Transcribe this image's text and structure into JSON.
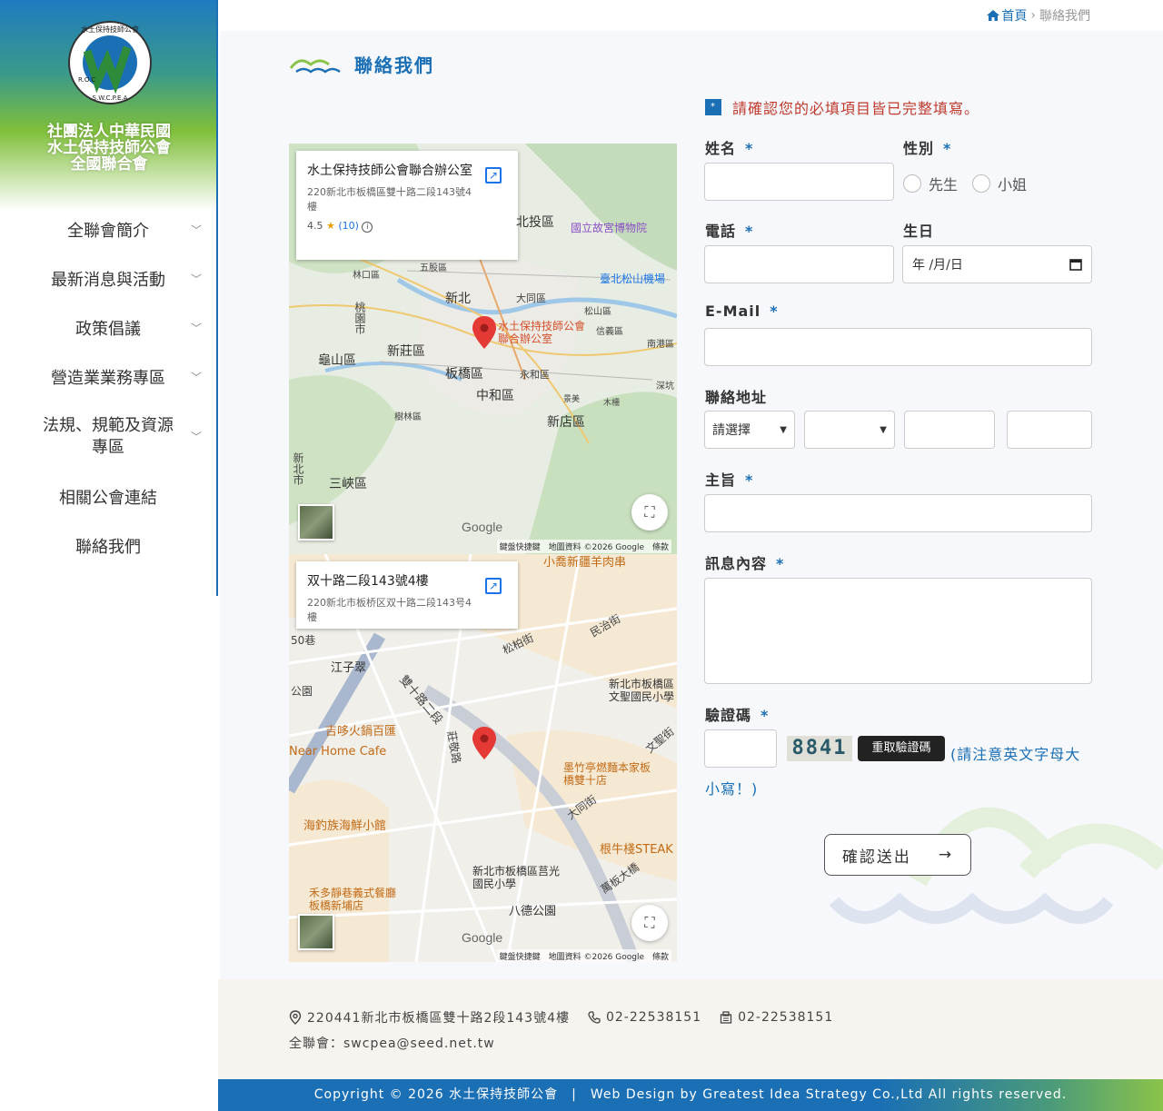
{
  "sidebar": {
    "org_name_line1": "社團法人中華民國",
    "org_name_line2": "水土保持技師公會",
    "org_name_line3": "全國聯合會",
    "logo_ring_text": "水土保持技師公會",
    "logo_left_text": "R.O.C",
    "logo_bottom_text": "S.W.C.P.E.A",
    "logo_letter": "W",
    "items": [
      {
        "label": "全聯會簡介",
        "has_submenu": true
      },
      {
        "label": "最新消息與活動",
        "has_submenu": true
      },
      {
        "label": "政策倡議",
        "has_submenu": true
      },
      {
        "label": "營造業業務專區",
        "has_submenu": true
      },
      {
        "label": "法規、規範及資源專區",
        "has_submenu": true
      },
      {
        "label": "相關公會連結",
        "has_submenu": false
      },
      {
        "label": "聯絡我們",
        "has_submenu": false
      }
    ]
  },
  "breadcrumb": {
    "home": "首頁",
    "separator": "›",
    "current": "聯絡我們"
  },
  "page_title": "聯絡我們",
  "map": {
    "top": {
      "card_title": "水土保持技師公會聯合辦公室",
      "card_address": "220新北市板橋區雙十路二段143號4樓",
      "rating": "4.5",
      "reviews": "(10)",
      "pin_label": "水土保持技師公會聯合辦公室",
      "places": [
        "北投區",
        "國立故宮博物院",
        "臺北松山機場",
        "五股區",
        "林口區",
        "新北",
        "大同區",
        "松山區",
        "信義區",
        "南港區",
        "新莊區",
        "龜山區",
        "板橋區",
        "永和區",
        "中和區",
        "景美",
        "木柵",
        "深坑",
        "樹林區",
        "新店區",
        "三峽區",
        "新北市",
        "桃園市"
      ],
      "footer": "鍵盤快捷鍵　地圖資料 ©2026 Google　條款",
      "google": "Google"
    },
    "bottom": {
      "card_title": "双十路二段143號4樓",
      "card_address": "220新北市板桥区双十路二段143号4樓",
      "places": [
        "小喬新疆羊肉串",
        "民治街",
        "松柏街",
        "50巷",
        "江子翠",
        "雙十路二段",
        "公園",
        "新北市板橋區文聖國民小學",
        "吉哆火鍋百匯",
        "Near Home Cafe",
        "莊敬路",
        "墨竹亭燃麵本家板橋雙十店",
        "文聖街",
        "大同街",
        "海釣族海鮮小館",
        "根牛棧STEAK",
        "萬板大橋",
        "新北市板橋區莒光國民小學",
        "禾多靜巷義式餐廳板橋新埔店",
        "八德公園"
      ],
      "footer": "鍵盤快捷鍵　地圖資料 ©2026 Google　條款",
      "google": "Google"
    }
  },
  "form": {
    "notice": "請確認您的必填項目皆已完整填寫。",
    "required_mark": "*",
    "name_label": "姓名",
    "gender_label": "性別",
    "gender_options": [
      "先生",
      "小姐"
    ],
    "phone_label": "電話",
    "birthday_label": "生日",
    "birthday_placeholder": "年 /月/日",
    "email_label": "E-Mail",
    "address_label": "聯絡地址",
    "address_select1": "請選擇",
    "subject_label": "主旨",
    "message_label": "訊息內容",
    "captcha_label": "驗證碼",
    "captcha_code": "8841",
    "captcha_refresh": "重取驗證碼",
    "captcha_note": "(請注意英文字母大小寫！)",
    "submit_label": "確認送出",
    "submit_arrow": "→"
  },
  "footer": {
    "address": "220441新北市板橋區雙十路2段143號4樓",
    "phone": "02-22538151",
    "fax": "02-22538151",
    "email_line": "全聯會：swcpea@seed.net.tw",
    "copyright": "Copyright © 2026 水土保持技師公會　|　Web Design by Greatest Idea Strategy Co.,Ltd All rights reserved."
  },
  "colors": {
    "brand_blue": "#1a6fb5",
    "brand_green": "#8bc34a",
    "alert_red": "#c0392b"
  }
}
